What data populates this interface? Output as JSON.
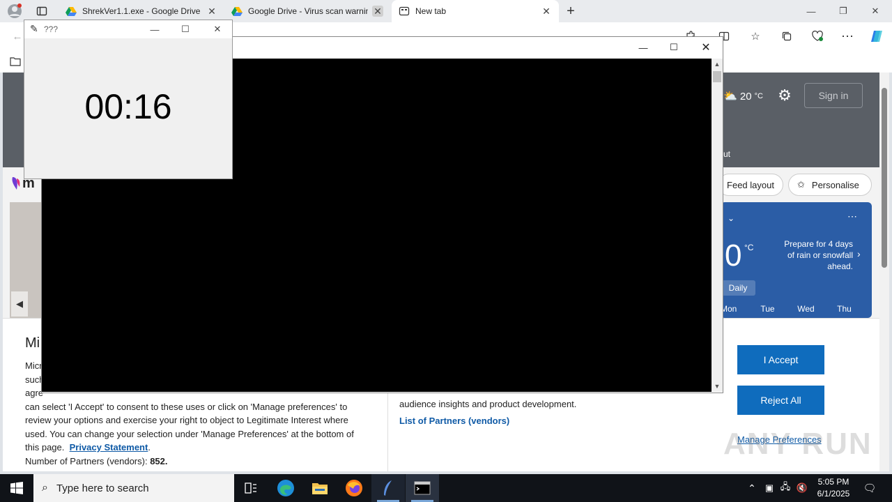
{
  "browser": {
    "tabs": [
      {
        "title": "ShrekVer1.1.exe - Google Drive",
        "active": false
      },
      {
        "title": "Google Drive - Virus scan warning",
        "active": false
      },
      {
        "title": "New tab",
        "active": true
      }
    ],
    "new_tab_symbol": "+",
    "window_controls": {
      "minimize": "—",
      "restore": "❐",
      "close": "✕"
    }
  },
  "page": {
    "weather_temp": "20",
    "weather_unit": "°C",
    "sign_in": "Sign in",
    "partial_label": "ut",
    "feed_layout": "Feed layout",
    "personalise": "Personalise",
    "widget": {
      "big_temp": "0",
      "big_unit": "°C",
      "forecast_note": "Prepare for 4 days of rain or snowfall ahead.",
      "daily_tab": "Daily",
      "days": [
        "Mon",
        "Tue",
        "Wed",
        "Thu"
      ]
    },
    "logo_partial": "m"
  },
  "consent": {
    "title_partial": "Mi",
    "left_lines": [
      "Micr",
      "such",
      "agre",
      "can select 'I Accept' to consent to these uses or click on 'Manage preferences' to",
      "review your options and exercise your right to object to Legitimate Interest where",
      "used.  You can change your selection under 'Manage Preferences' at the bottom of",
      "this page."
    ],
    "privacy_link": "Privacy Statement",
    "partners_label": "Number of Partners (vendors):",
    "partners_count": "852.",
    "right_line": "audience insights and product development.",
    "list_link": "List of Partners (vendors)",
    "accept": "I Accept",
    "reject": "Reject All",
    "manage": "Manage Preferences"
  },
  "timer_window": {
    "title": "???",
    "time": "00:16"
  },
  "watermark": "ANY RUN",
  "taskbar": {
    "search_placeholder": "Type here to search",
    "time": "5:05 PM",
    "date": "6/1/2025"
  },
  "colors": {
    "accent": "#0f6cbd",
    "taskbar": "#101318"
  }
}
